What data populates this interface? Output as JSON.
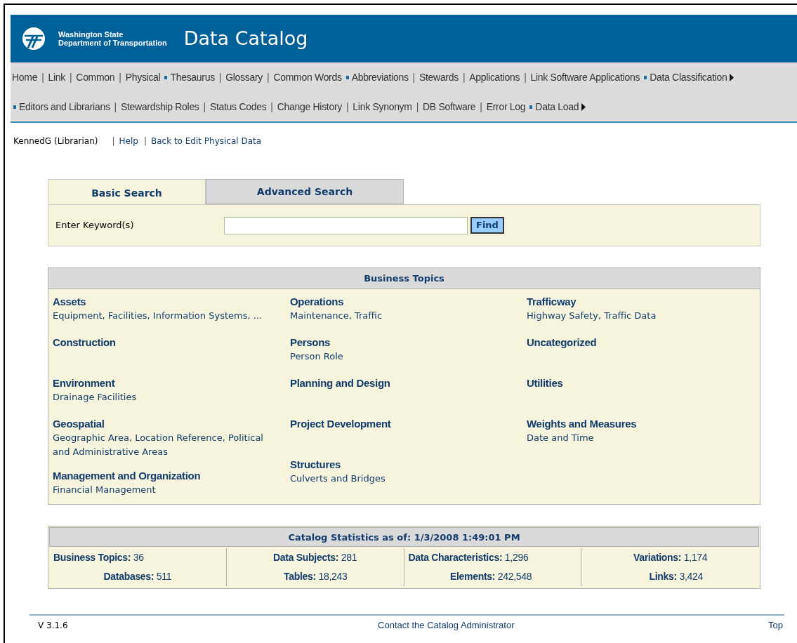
{
  "header": {
    "agency_line_1": "Washington State",
    "agency_line_2": "Department of Transportation",
    "title": "Data Catalog"
  },
  "nav_rows": [
    [
      {
        "kind": "link",
        "label": "Home"
      },
      {
        "kind": "separator",
        "text": "|"
      },
      {
        "kind": "link",
        "label": "Link"
      },
      {
        "kind": "separator",
        "text": "|"
      },
      {
        "kind": "link",
        "label": "Common"
      },
      {
        "kind": "separator",
        "text": "|"
      },
      {
        "kind": "link",
        "label": "Physical"
      },
      {
        "kind": "bullet"
      },
      {
        "kind": "link",
        "label": "Thesaurus"
      },
      {
        "kind": "separator",
        "text": "|"
      },
      {
        "kind": "link",
        "label": "Glossary"
      },
      {
        "kind": "separator",
        "text": "|"
      },
      {
        "kind": "link",
        "label": "Common Words"
      },
      {
        "kind": "bullet"
      },
      {
        "kind": "link",
        "label": "Abbreviations"
      },
      {
        "kind": "separator",
        "text": "|"
      },
      {
        "kind": "link",
        "label": "Stewards"
      },
      {
        "kind": "separator",
        "text": "|"
      },
      {
        "kind": "link",
        "label": "Applications"
      },
      {
        "kind": "separator",
        "text": "|"
      },
      {
        "kind": "link",
        "label": "Link Software Applications"
      },
      {
        "kind": "bullet"
      },
      {
        "kind": "submenu",
        "label": "Data Classification"
      }
    ],
    [
      {
        "kind": "bullet"
      },
      {
        "kind": "link",
        "label": "Editors and Librarians"
      },
      {
        "kind": "separator",
        "text": "|"
      },
      {
        "kind": "link",
        "label": "Stewardship Roles"
      },
      {
        "kind": "separator",
        "text": "|"
      },
      {
        "kind": "link",
        "label": "Status Codes"
      },
      {
        "kind": "separator",
        "text": "|"
      },
      {
        "kind": "link",
        "label": "Change History"
      },
      {
        "kind": "separator",
        "text": "|"
      },
      {
        "kind": "link",
        "label": "Link Synonym"
      },
      {
        "kind": "separator",
        "text": "|"
      },
      {
        "kind": "link",
        "label": "DB Software"
      },
      {
        "kind": "separator",
        "text": "|"
      },
      {
        "kind": "link",
        "label": "Error Log"
      },
      {
        "kind": "bullet"
      },
      {
        "kind": "submenu",
        "label": "Data Load"
      }
    ]
  ],
  "user_bar": [
    {
      "kind": "text",
      "text": "KennedG (Librarian)"
    },
    {
      "kind": "separator",
      "text": "|"
    },
    {
      "kind": "link",
      "text": "Help"
    },
    {
      "kind": "separator",
      "text": "|"
    },
    {
      "kind": "link",
      "text": "Back to Edit Physical Data"
    }
  ],
  "search": {
    "tabs": [
      {
        "label": "Basic Search",
        "selected": true
      },
      {
        "label": "Advanced Search",
        "selected": false
      }
    ],
    "label": "Enter Keyword(s)",
    "button": "Find"
  },
  "business_topics": {
    "heading": "Business Topics",
    "columns": [
      [
        {
          "title": "Assets",
          "subtitle": "Equipment, Facilities, Information Systems, ..."
        },
        {
          "title": "Construction"
        },
        {
          "title": "Environment",
          "subtitle": "Drainage Facilities"
        },
        {
          "title": "Geospatial",
          "subtitle": "Geographic Area, Location Reference, Political and Administrative Areas"
        },
        {
          "title": "Management and Organization",
          "subtitle": "Financial Management"
        }
      ],
      [
        {
          "title": "Operations",
          "subtitle": "Maintenance, Traffic"
        },
        {
          "title": "Persons",
          "subtitle": "Person Role"
        },
        {
          "title": "Planning and Design"
        },
        {
          "title": "Project Development"
        },
        {
          "title": "Structures",
          "subtitle": "Culverts and Bridges"
        }
      ],
      [
        {
          "title": "Trafficway",
          "subtitle": "Highway Safety, Traffic Data"
        },
        {
          "title": "Uncategorized"
        },
        {
          "title": "Utilities"
        },
        {
          "title": "Weights and Measures",
          "subtitle": "Date and Time"
        }
      ]
    ]
  },
  "statistics": {
    "heading": "Catalog Statistics as of: 1/3/2008 1:49:01 PM",
    "rows": [
      [
        {
          "label": "Business Topics:",
          "value": "36"
        },
        {
          "label": "Data Subjects:",
          "value": "281"
        },
        {
          "label": "Data Characteristics:",
          "value": "1,296"
        },
        {
          "label": "Variations:",
          "value": "1,174"
        }
      ],
      [
        {
          "label": "Databases:",
          "value": "511"
        },
        {
          "label": "Tables:",
          "value": "18,243"
        },
        {
          "label": "Elements:",
          "value": "242,548"
        },
        {
          "label": "Links:",
          "value": "3,424"
        }
      ]
    ]
  },
  "footer": {
    "version": "V 3.1.6",
    "contact": "Contact the Catalog Administrator",
    "top": "Top"
  }
}
